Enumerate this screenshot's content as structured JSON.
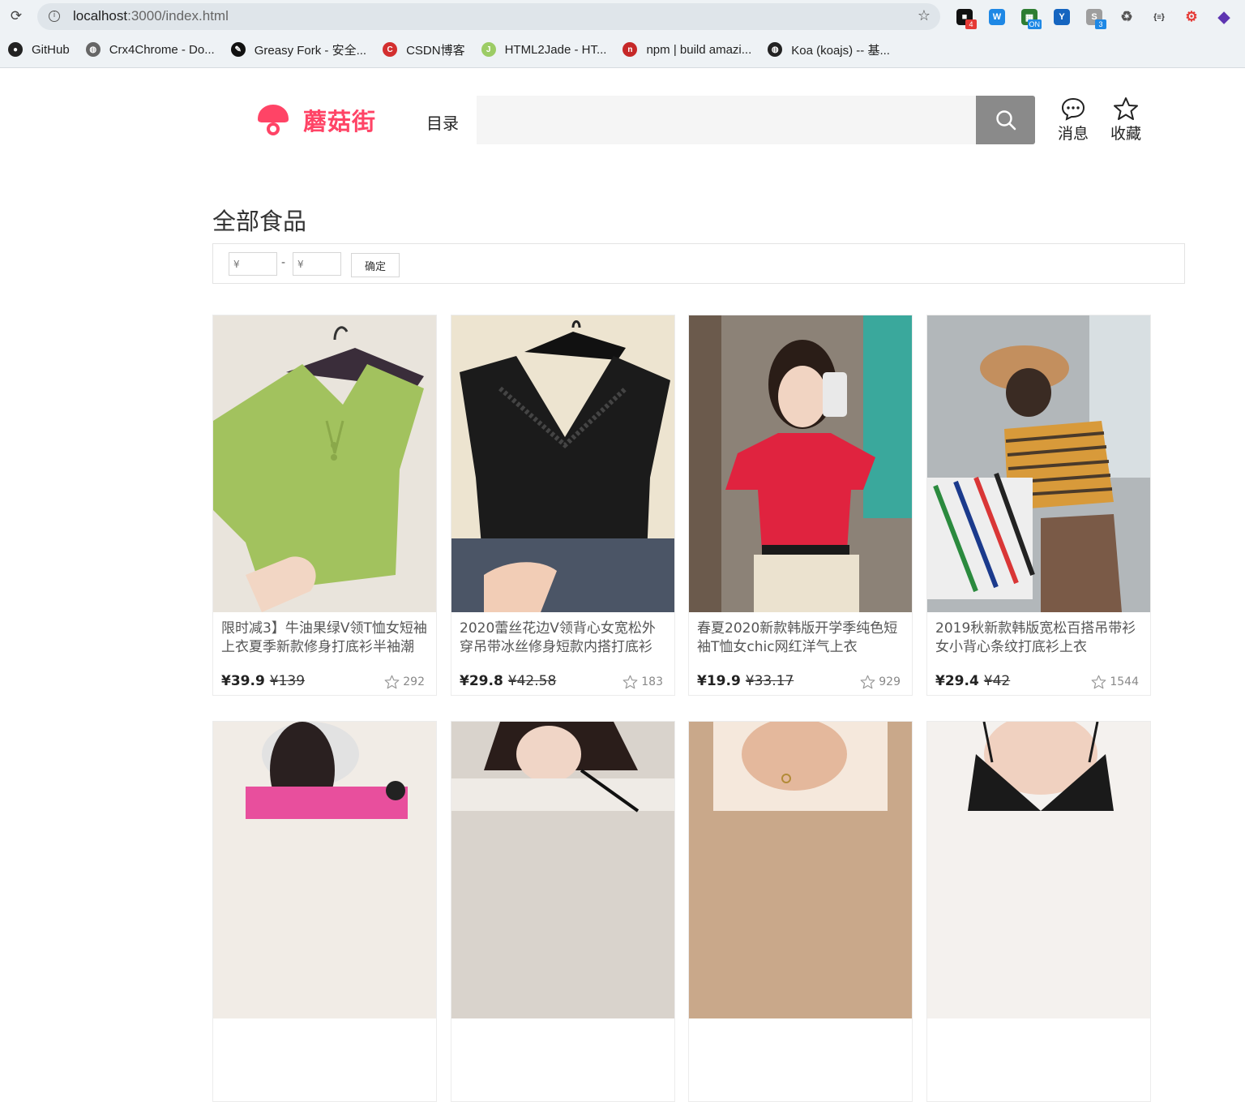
{
  "browser": {
    "url_host": "localhost",
    "url_rest": ":3000/index.html",
    "extensions": [
      {
        "name": "ext-notes-icon",
        "glyph": "■",
        "color": "#111111",
        "badge": "4",
        "badge_color": "#e53935"
      },
      {
        "name": "ext-wps-icon",
        "glyph": "W",
        "color": "#1e88e5",
        "badge": "",
        "badge_color": ""
      },
      {
        "name": "ext-toggle-icon",
        "glyph": "▦",
        "color": "#2e7d32",
        "badge": "ON",
        "badge_color": "#1e88e5"
      },
      {
        "name": "ext-vue-icon",
        "glyph": "Y",
        "color": "#1565c0",
        "badge": "",
        "badge_color": ""
      },
      {
        "name": "ext-s-icon",
        "glyph": "S",
        "color": "#9e9e9e",
        "badge": "3",
        "badge_color": "#1e88e5"
      },
      {
        "name": "ext-recycle-icon",
        "glyph": "♻",
        "color": "#555555",
        "badge": "",
        "badge_color": ""
      },
      {
        "name": "ext-json-icon",
        "glyph": "{≡}",
        "color": "#333333",
        "badge": "",
        "badge_color": ""
      },
      {
        "name": "ext-network-icon",
        "glyph": "⚙",
        "color": "#e53935",
        "badge": "",
        "badge_color": ""
      },
      {
        "name": "ext-gem-icon",
        "glyph": "◆",
        "color": "#5e35b1",
        "badge": "",
        "badge_color": ""
      }
    ],
    "bookmarks": [
      {
        "label": "GitHub",
        "color": "#222222",
        "glyph": "●"
      },
      {
        "label": "Crx4Chrome - Do...",
        "color": "#666666",
        "glyph": "◍"
      },
      {
        "label": "Greasy Fork - 安全...",
        "color": "#111111",
        "glyph": "✎"
      },
      {
        "label": "CSDN博客",
        "color": "#d32f2f",
        "glyph": "C"
      },
      {
        "label": "HTML2Jade - HT...",
        "color": "#9ccc65",
        "glyph": "J"
      },
      {
        "label": "npm | build amazi...",
        "color": "#c62828",
        "glyph": "n"
      },
      {
        "label": "Koa (koajs) -- 基...",
        "color": "#222222",
        "glyph": "◍"
      }
    ]
  },
  "header": {
    "brand": "蘑菇街",
    "catalog": "目录",
    "search_placeholder": "",
    "messages_label": "消息",
    "favorites_label": "收藏"
  },
  "section": {
    "title": "全部食品",
    "min_placeholder": "¥",
    "max_placeholder": "¥",
    "dash": "-",
    "confirm_label": "确定"
  },
  "products": [
    {
      "title": "限时减3】牛油果绿V领T恤女短袖上衣夏季新款修身打底衫半袖潮",
      "price": "¥39.9",
      "old_price": "¥139",
      "favs": "292",
      "img": "green-tee"
    },
    {
      "title": "2020蕾丝花边V领背心女宽松外穿吊带冰丝修身短款内搭打底衫",
      "price": "¥29.8",
      "old_price": "¥42.58",
      "favs": "183",
      "img": "black-lace"
    },
    {
      "title": "春夏2020新款韩版开学季纯色短袖T恤女chic网红洋气上衣",
      "price": "¥19.9",
      "old_price": "¥33.17",
      "favs": "929",
      "img": "red-tee"
    },
    {
      "title": "2019秋新款韩版宽松百搭吊带衫女小背心条纹打底衫上衣",
      "price": "¥29.4",
      "old_price": "¥42",
      "favs": "1544",
      "img": "stripe-tank"
    },
    {
      "title": "",
      "price": "",
      "old_price": "",
      "favs": "",
      "img": "pink-print"
    },
    {
      "title": "",
      "price": "",
      "old_price": "",
      "favs": "",
      "img": "white-tee"
    },
    {
      "title": "",
      "price": "",
      "old_price": "",
      "favs": "",
      "img": "cream-top"
    },
    {
      "title": "",
      "price": "",
      "old_price": "",
      "favs": "",
      "img": "black-cami"
    }
  ],
  "colors": {
    "brand": "#ff4466",
    "search_button": "#8a8a8a"
  }
}
